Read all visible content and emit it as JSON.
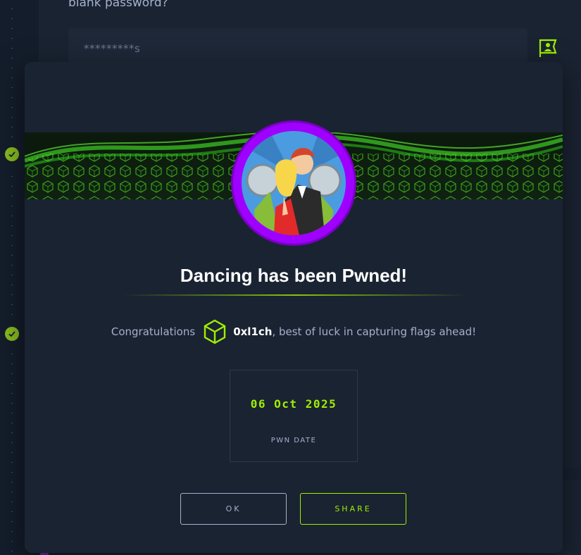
{
  "background": {
    "question_text": "blank password?",
    "answer_value": "*********s",
    "checks": [
      "completed-task-1",
      "completed-task-2"
    ]
  },
  "modal": {
    "title": "Dancing has been Pwned!",
    "congrats": {
      "prefix": "Congratulations",
      "username": "0xl1ch",
      "suffix": ", best of luck in capturing flags ahead!"
    },
    "pwn_date": {
      "value": "06 Oct 2025",
      "label": "PWN DATE"
    },
    "buttons": {
      "ok": "OK",
      "share": "SHARE"
    }
  },
  "colors": {
    "accent_green": "#9fef00",
    "avatar_ring": "#9f00ff",
    "modal_bg": "#1a2332",
    "page_bg": "#141d2b"
  },
  "icons": {
    "avatar": "dancing-couple-avatar",
    "cube": "hackthebox-cube-icon",
    "flag": "flag-user-icon",
    "check": "check-icon"
  }
}
